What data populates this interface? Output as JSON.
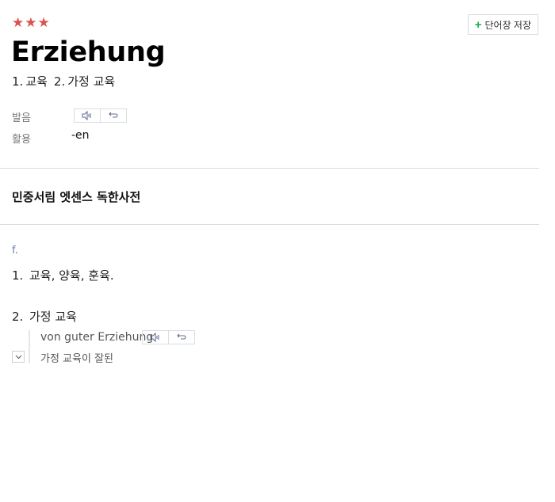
{
  "entry": {
    "stars": "★★★",
    "headword": "Erziehung",
    "meanings": [
      {
        "num": "1.",
        "text": "교육"
      },
      {
        "num": "2.",
        "text": "가정 교육"
      }
    ]
  },
  "toolbar": {
    "save_label": "단어장 저장",
    "save_icon": "plus-icon"
  },
  "info": {
    "pronunciation_label": "발음",
    "inflection_label": "활용",
    "inflection_value": "-en"
  },
  "dictionary": {
    "name": "민중서림 엣센스 독한사전",
    "pos": "f.",
    "senses": [
      {
        "num": "1.",
        "text": "교육, 양육, 훈육."
      },
      {
        "num": "2.",
        "text": "가정 교육"
      }
    ],
    "example": {
      "text": "von guter Erziehung",
      "translation": "가정 교육이 잘된"
    }
  },
  "colors": {
    "stars": "#d9534f",
    "plus": "#19b34c",
    "pos": "#6b7fa8"
  }
}
